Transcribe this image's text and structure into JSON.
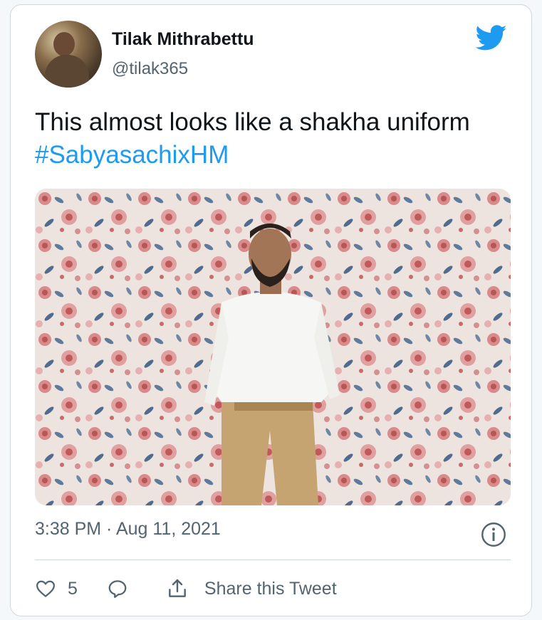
{
  "tweet": {
    "author_name": "Tilak Mithrabettu",
    "author_handle": "@tilak365",
    "text_plain": "This almost looks like a shakha uniform ",
    "hashtag": "#SabyasachixHM",
    "timestamp": "3:38 PM · Aug 11, 2021",
    "like_count": "5",
    "share_label": "Share this Tweet"
  },
  "icons": {
    "brand": "twitter-bird-icon",
    "info": "info-icon",
    "like": "heart-icon",
    "reply": "reply-bubble-icon",
    "share": "share-icon"
  },
  "colors": {
    "brand_blue": "#1d9bf0",
    "text_primary": "#0f1419",
    "text_secondary": "#536471",
    "border": "#cfd9de"
  }
}
